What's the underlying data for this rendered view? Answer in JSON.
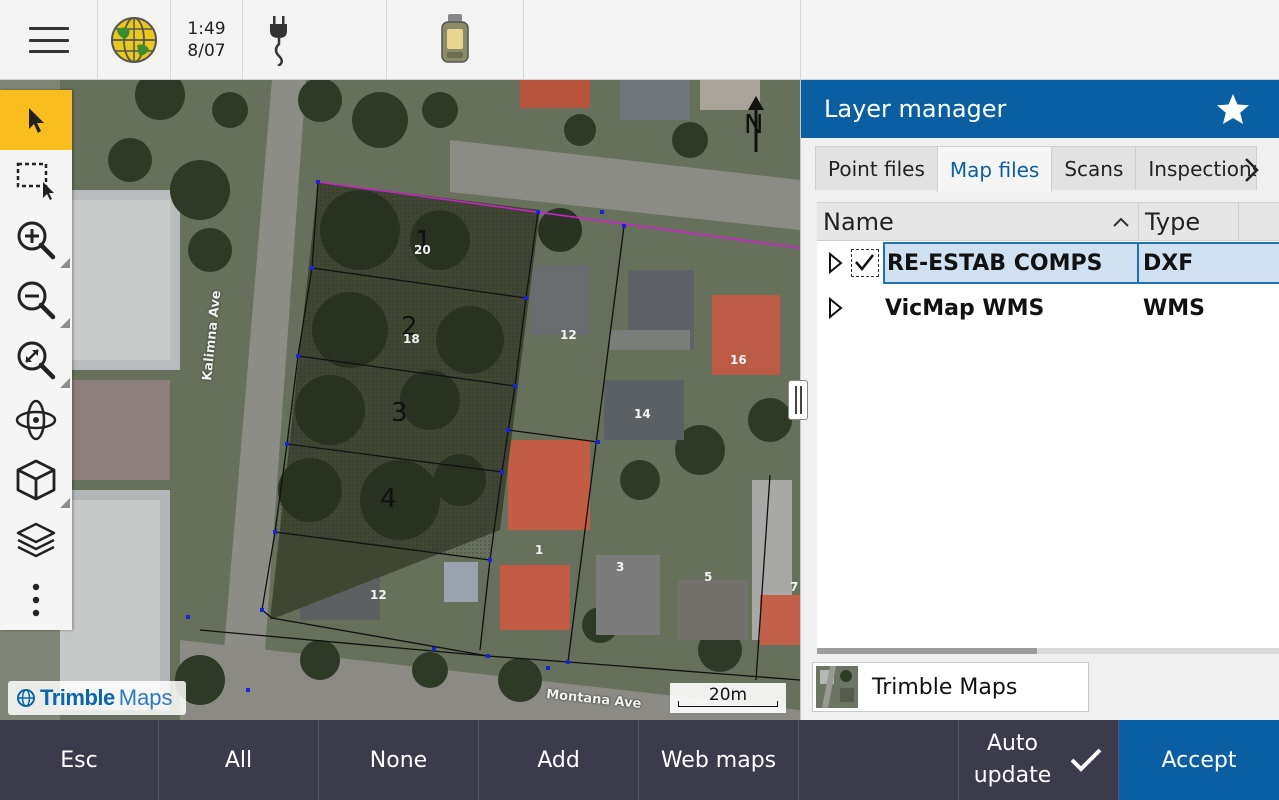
{
  "status": {
    "time": "1:49",
    "date": "8/07",
    "icons": [
      "menu-icon",
      "gnss-globe-icon",
      "power-plug-icon",
      "controller-device-icon"
    ]
  },
  "map": {
    "north_label": "N",
    "lots": [
      "1",
      "2",
      "3",
      "4"
    ],
    "house_numbers": [
      "20",
      "18",
      "12",
      "16",
      "14",
      "1",
      "3",
      "5",
      "7",
      "12"
    ],
    "streets": {
      "kalimna": "Kalimna Ave",
      "montana": "Montana Ave"
    },
    "scale_label": "20m",
    "logo": {
      "brand": "Trimble",
      "product": "Maps"
    },
    "colors": {
      "parcel_line": "#cc22cc",
      "boundary": "#111111",
      "node": "#1a22dd"
    }
  },
  "tools": [
    {
      "name": "select-tool",
      "icon": "arrow-pointer-icon",
      "active": true
    },
    {
      "name": "box-select-tool",
      "icon": "box-select-icon"
    },
    {
      "name": "zoom-in-tool",
      "icon": "zoom-in-icon"
    },
    {
      "name": "zoom-out-tool",
      "icon": "zoom-out-icon"
    },
    {
      "name": "zoom-extents-tool",
      "icon": "zoom-extents-icon"
    },
    {
      "name": "orbit-tool",
      "icon": "orbit-icon"
    },
    {
      "name": "view-3d-tool",
      "icon": "cube-icon"
    },
    {
      "name": "layers-tool",
      "icon": "layers-icon"
    },
    {
      "name": "more-tool",
      "icon": "more-vertical-icon"
    }
  ],
  "panel": {
    "title": "Layer manager",
    "tabs": [
      "Point files",
      "Map files",
      "Scans",
      "Inspections"
    ],
    "active_tab": "Map files",
    "columns": {
      "name": "Name",
      "type": "Type"
    },
    "rows": [
      {
        "name": "RE-ESTAB COMPS",
        "type": "DXF",
        "checked": true,
        "selected": true
      },
      {
        "name": "VicMap WMS",
        "type": "WMS",
        "checked": false,
        "selected": false
      }
    ],
    "basemap": "Trimble Maps",
    "accent": "#0a5fa3"
  },
  "bottom": {
    "esc": "Esc",
    "all": "All",
    "none": "None",
    "add": "Add",
    "web_maps": "Web maps",
    "auto_update_line1": "Auto",
    "auto_update_line2": "update",
    "accept": "Accept"
  }
}
